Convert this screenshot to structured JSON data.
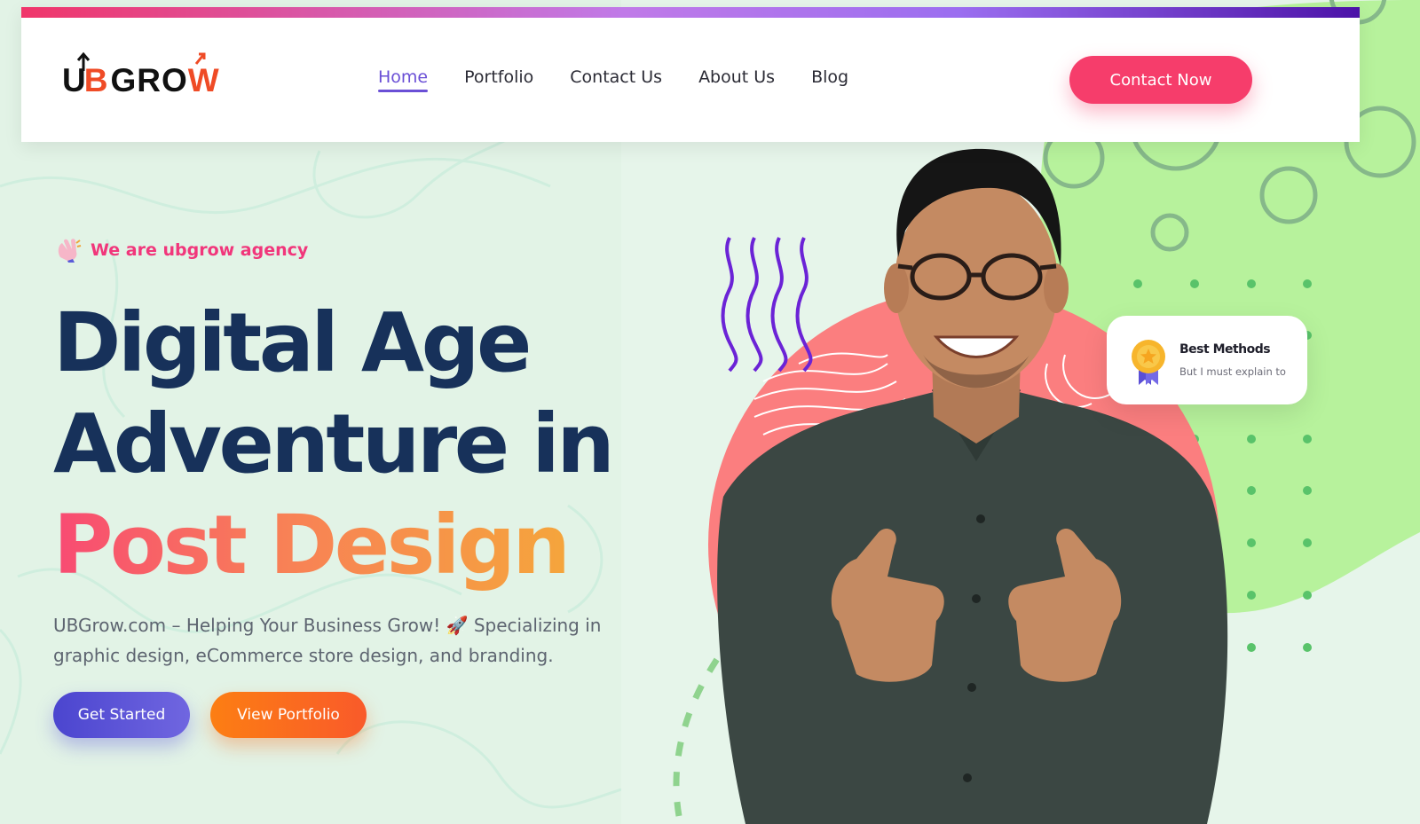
{
  "brand": {
    "logo_u": "U",
    "logo_b": "B",
    "logo_grow": "GRO",
    "logo_w": "W",
    "accent": "#f63d6b",
    "logo_orange": "#ef4b26"
  },
  "nav": {
    "items": [
      {
        "label": "Home",
        "active": true
      },
      {
        "label": "Portfolio",
        "active": false
      },
      {
        "label": "Contact Us",
        "active": false
      },
      {
        "label": "About Us",
        "active": false
      },
      {
        "label": "Blog",
        "active": false
      }
    ],
    "cta_label": "Contact Now"
  },
  "hero": {
    "tagline": "We are ubgrow agency",
    "tagline_icon": "waving-hand-icon",
    "title_line1": "Digital Age",
    "title_line2": "Adventure in",
    "title_line3": "Post Design",
    "description": "UBGrow.com – Helping Your Business Grow! 🚀 Specializing in graphic design, eCommerce store design, and branding.",
    "primary_button": "Get Started",
    "secondary_button": "View Portfolio",
    "title_color": "#17315a",
    "tagline_color": "#f1367b"
  },
  "card": {
    "icon": "medal-icon",
    "title": "Best Methods",
    "subtitle": "But I must explain to"
  },
  "image": {
    "subject": "smiling-man-thumbs-up-photo",
    "circle_color": "#fb7e7f",
    "accent_green": "#b4f29a"
  }
}
